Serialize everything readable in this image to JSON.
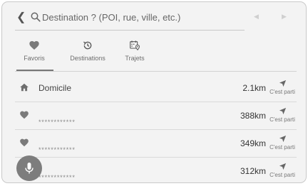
{
  "search": {
    "back_icon": "chevron-left-icon",
    "placeholder": "Destination ? (POI, rue, ville, etc.)"
  },
  "pager": {
    "prev_icon": "triangle-left-icon",
    "next_icon": "triangle-right-icon"
  },
  "tabs": [
    {
      "label": "Favoris",
      "icon": "heart-icon",
      "active": true
    },
    {
      "label": "Destinations",
      "icon": "history-icon",
      "active": false
    },
    {
      "label": "Trajets",
      "icon": "calendar-pin-icon",
      "active": false
    }
  ],
  "rows": [
    {
      "icon": "home-icon",
      "name": "Domicile",
      "distance": "2.1km",
      "go_label": "C'est parti"
    },
    {
      "icon": "heart-icon",
      "name": "************",
      "distance": "388km",
      "go_label": "C'est parti"
    },
    {
      "icon": "heart-icon",
      "name": "************",
      "distance": "349km",
      "go_label": "C'est parti"
    },
    {
      "icon": "heart-icon",
      "name": "************",
      "distance": "312km",
      "go_label": "C'est parti"
    }
  ],
  "mic": {
    "icon": "microphone-icon"
  },
  "colors": {
    "background": "#f3f3f3",
    "text": "#444444",
    "muted": "#888888",
    "mic_button": "#7d7d7d"
  }
}
